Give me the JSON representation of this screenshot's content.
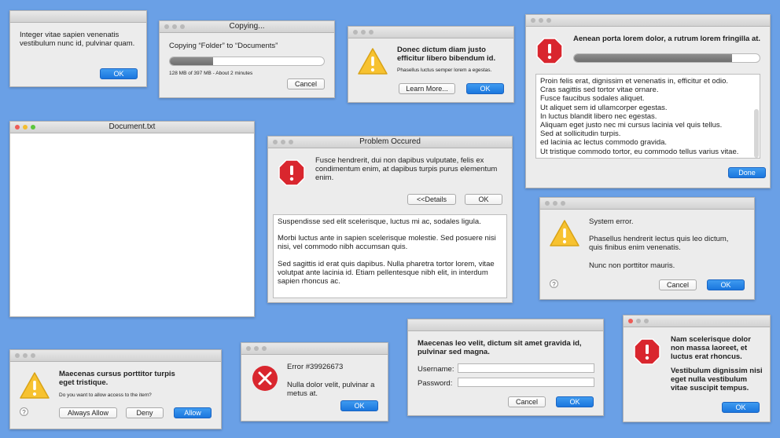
{
  "colors": {
    "desktop": "#6aa0e6",
    "accent": "#1a76de",
    "error_red": "#d9262e",
    "warning_yellow": "#f7c230"
  },
  "w1": {
    "message": "Integer vitae sapien venenatis vestibulum nunc id, pulvinar quam.",
    "ok": "OK"
  },
  "w2": {
    "title": "Copying...",
    "message": "Copying “Folder” to “Documents”",
    "progress": 0.28,
    "status": "128 MB of 397 MB - About 2 minutes",
    "cancel": "Cancel"
  },
  "w3": {
    "icon": "warning-icon",
    "title": "Donec dictum diam justo efficitur libero bibendum id.",
    "message": "Phasellus luctus semper lorem a egestas.",
    "learn_more": "Learn More...",
    "ok": "OK"
  },
  "w4": {
    "icon": "stop-icon",
    "title": "Aenean porta lorem dolor, a rutrum lorem fringilla at.",
    "progress": 0.85,
    "lines": [
      "Proin felis erat, dignissim et venenatis in, efficitur et odio.",
      "Cras sagittis sed tortor vitae ornare.",
      "Fusce faucibus sodales aliquet.",
      "Ut aliquet sem id ullamcorper egestas.",
      "In luctus blandit libero nec egestas.",
      "Aliquam eget justo nec mi cursus lacinia vel quis tellus.",
      "Sed at sollicitudin turpis.",
      "ed lacinia ac lectus commodo gravida.",
      "Ut tristique commodo tortor, eu commodo tellus varius vitae."
    ],
    "done": "Done"
  },
  "w5": {
    "title": "Document.txt"
  },
  "w6": {
    "title": "Problem Occured",
    "icon": "stop-icon",
    "message": "Fusce hendrerit, dui non dapibus vulputate, felis ex condimentum enim, at dapibus turpis purus elementum enim.",
    "details": "<<Details",
    "ok": "OK",
    "p1": "Suspendisse sed elit scelerisque, luctus mi ac, sodales ligula.",
    "p2": "Morbi luctus ante in sapien scelerisque molestie. Sed posuere nisi nisi, vel commodo nibh accumsan quis.",
    "p3": "Sed sagittis id erat quis dapibus. Nulla pharetra tortor lorem, vitae volutpat ante lacinia id. Etiam pellentesque nibh elit, in interdum sapien rhoncus ac."
  },
  "w7": {
    "icon": "warning-icon",
    "title": "System error.",
    "p1": "Phasellus hendrerit lectus quis leo dictum, quis finibus enim venenatis.",
    "p2": "Nunc non porttitor mauris.",
    "help": "?",
    "cancel": "Cancel",
    "ok": "OK"
  },
  "w8": {
    "icon": "warning-icon",
    "title": "Maecenas cursus porttitor turpis eget tristique.",
    "message": "Do you want to allow access to the item?",
    "help": "?",
    "always_allow": "Always Allow",
    "deny": "Deny",
    "allow": "Allow"
  },
  "w9": {
    "icon": "error-x-icon",
    "title": "Error #39926673",
    "message": "Nulla dolor velit, pulvinar a metus at.",
    "ok": "OK"
  },
  "w10": {
    "title": "Maecenas leo velit, dictum sit amet gravida id, pulvinar sed magna.",
    "username_label": "Username:",
    "password_label": "Password:",
    "username_value": "",
    "password_value": "",
    "cancel": "Cancel",
    "ok": "OK"
  },
  "w11": {
    "icon": "stop-icon",
    "title": "Nam scelerisque dolor non massa laoreet, et luctus erat rhoncus.",
    "message": "Vestibulum dignissim nisi eget nulla vestibulum vitae suscipit tempus.",
    "ok": "OK"
  }
}
